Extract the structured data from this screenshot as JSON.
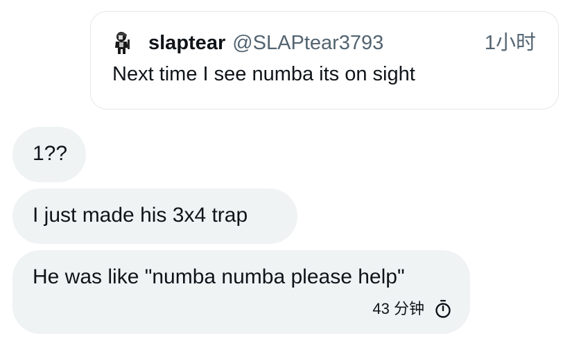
{
  "quoted_post": {
    "author_name": "slaptear",
    "author_handle": "@SLAPtear3793",
    "time": "1小时",
    "text": "Next time I see numba its on sight",
    "avatar_icon": "character-avatar-icon"
  },
  "messages": [
    {
      "text": "1??"
    },
    {
      "text": "I just made his 3x4 trap"
    },
    {
      "text": "He was like \"numba numba please help\"",
      "time": "43 分钟",
      "status_icon": "disappearing-timer-icon"
    }
  ],
  "colors": {
    "bubble_bg": "#eff3f4",
    "secondary_text": "#536471",
    "primary_text": "#0f1419",
    "card_border": "#e3e6e8"
  }
}
